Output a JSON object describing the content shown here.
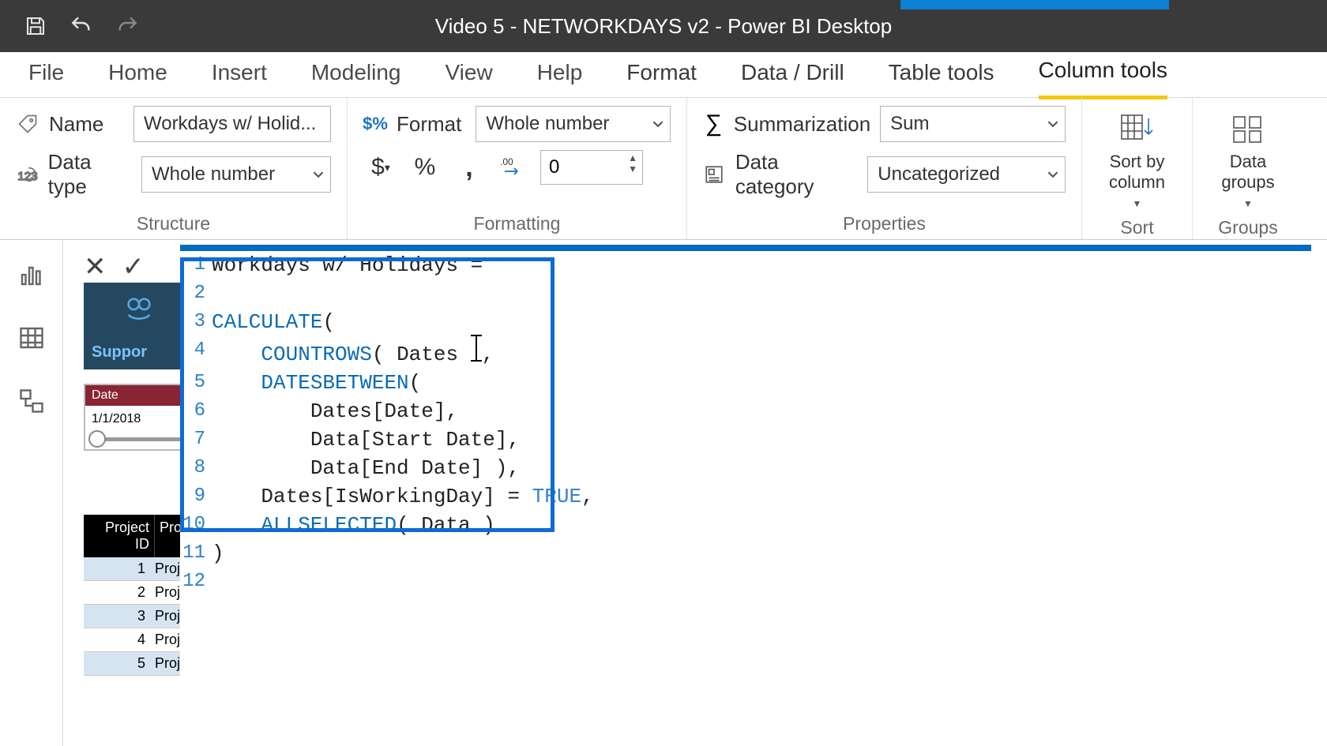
{
  "app_title": "Video 5 - NETWORKDAYS v2 - Power BI Desktop",
  "tabs": {
    "file": "File",
    "home": "Home",
    "insert": "Insert",
    "modeling": "Modeling",
    "view": "View",
    "help": "Help",
    "format": "Format",
    "datadrill": "Data / Drill",
    "tabletools": "Table tools",
    "columntools": "Column tools"
  },
  "structure": {
    "name_label": "Name",
    "name_value": "Workdays w/ Holid...",
    "datatype_label": "Data type",
    "datatype_value": "Whole number",
    "group_label": "Structure"
  },
  "formatting": {
    "format_label": "Format",
    "format_value": "Whole number",
    "decimal_value": "0",
    "group_label": "Formatting"
  },
  "properties": {
    "summarization_label": "Summarization",
    "summarization_value": "Sum",
    "datacategory_label": "Data category",
    "datacategory_value": "Uncategorized",
    "group_label": "Properties"
  },
  "sort": {
    "label": "Sort by\ncolumn",
    "group_label": "Sort"
  },
  "groups": {
    "label": "Data\ngroups",
    "group_label": "Groups"
  },
  "formula": {
    "l1_a": "Workdays w/ Holidays = ",
    "l3_a": "CALCULATE",
    "l3_b": "(",
    "l4_a": "    ",
    "l4_b": "COUNTROWS",
    "l4_c": "( Dates ",
    "l4_d": ",",
    "l5_a": "    ",
    "l5_b": "DATESBETWEEN",
    "l5_c": "(",
    "l6": "        Dates[Date],",
    "l7": "        Data[Start Date],",
    "l8": "        Data[End Date] ),",
    "l9_a": "    Dates[IsWorkingDay] = ",
    "l9_b": "TRUE",
    "l9_c": ",",
    "l10_a": "    ",
    "l10_b": "ALLSELECTED",
    "l10_c": "( Data )",
    "l11": ")"
  },
  "bg": {
    "support": "Suppor",
    "slicer_header": "Date",
    "slicer_value": "1/1/2018",
    "th1": "Project ID",
    "th2": "Proj",
    "r1a": "1",
    "r1b": "Proje",
    "r2a": "2",
    "r2b": "Proje",
    "r3a": "3",
    "r3b": "Proje",
    "r4a": "4",
    "r4b": "Proje",
    "r5a": "5",
    "r5b": "Proje"
  }
}
